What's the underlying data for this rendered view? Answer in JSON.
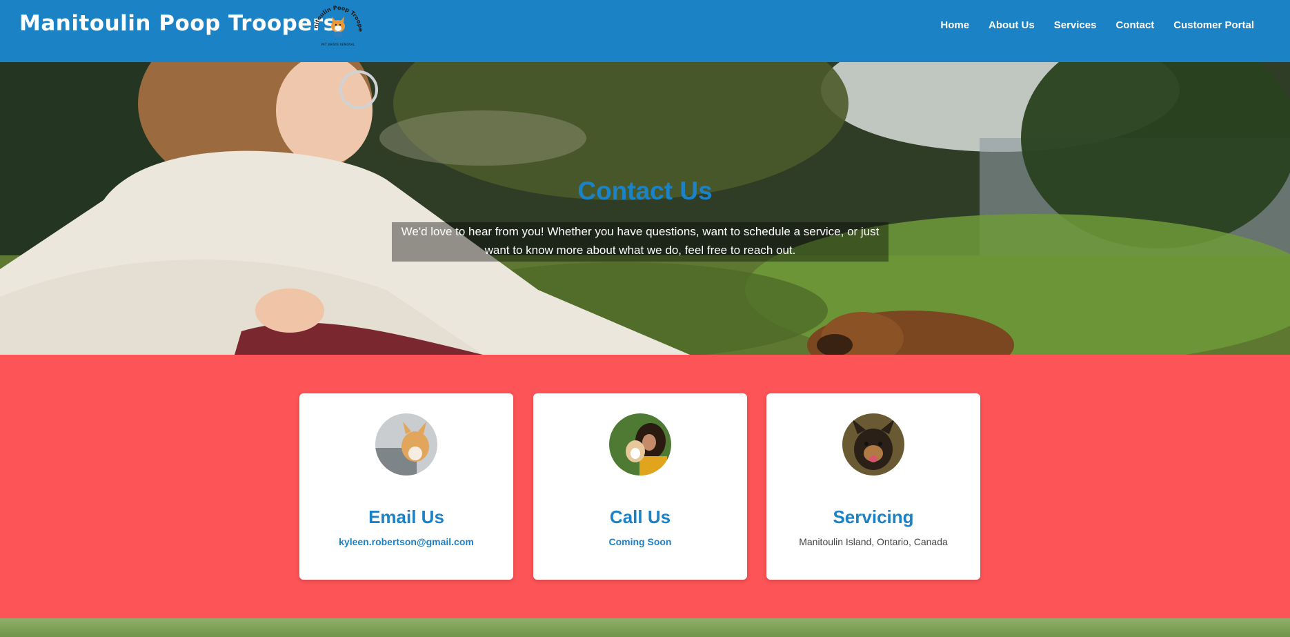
{
  "header": {
    "brand": "Manitoulin Poop Troopers",
    "logo_text_top": "Manitoulin Poop Troopers",
    "logo_text_bottom": "PET WASTE REMOVAL",
    "nav": [
      "Home",
      "About Us",
      "Services",
      "Contact",
      "Customer Portal"
    ]
  },
  "hero": {
    "title": "Contact Us",
    "text": "We'd love to hear from you! Whether you have questions, want to schedule a service, or just want to know more about what we do, feel free to reach out."
  },
  "cards": [
    {
      "title": "Email Us",
      "detail": "kyleen.robertson@gmail.com"
    },
    {
      "title": "Call Us",
      "detail": "Coming Soon"
    },
    {
      "title": "Servicing",
      "detail": "Manitoulin Island, Ontario, Canada"
    }
  ],
  "colors": {
    "primary_blue": "#1b82c6",
    "section_red": "#fd5457",
    "white": "#ffffff"
  }
}
